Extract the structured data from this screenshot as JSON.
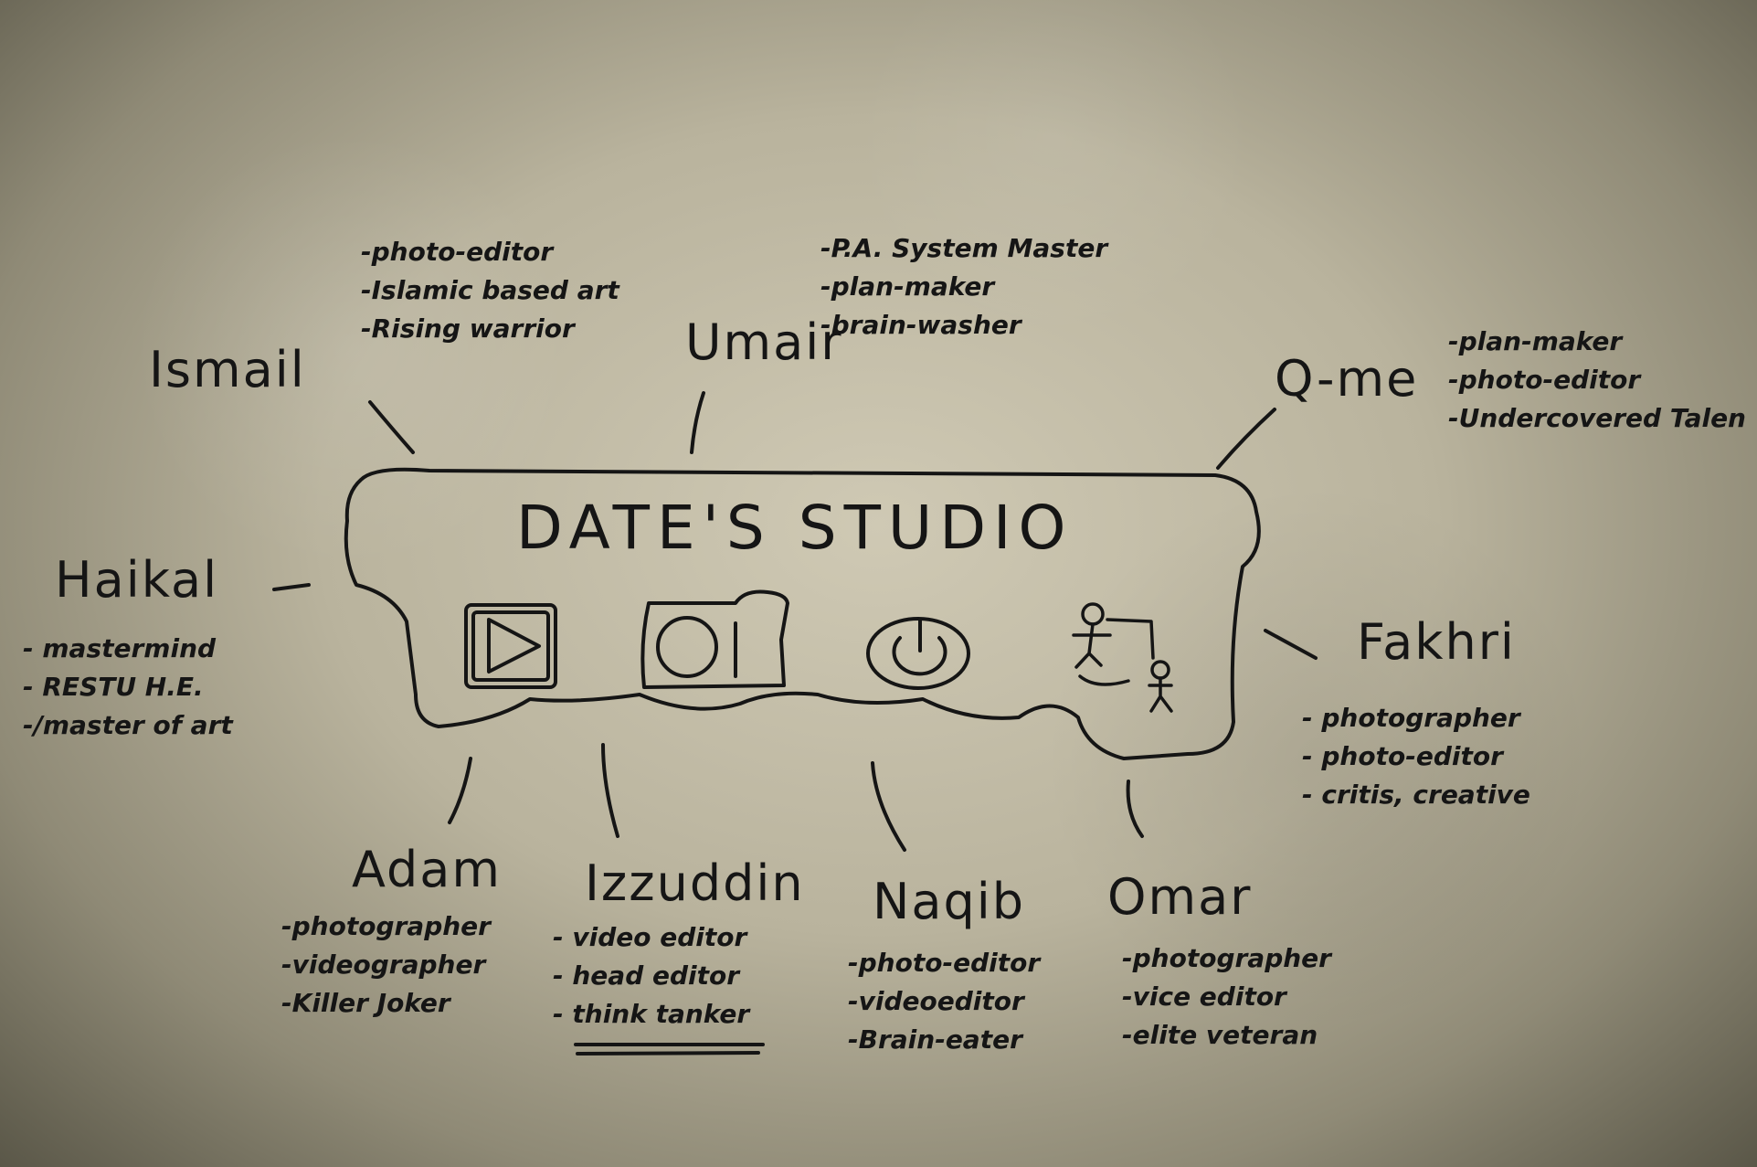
{
  "studio": {
    "title": "DATE'S STUDIO"
  },
  "icons": [
    "play-icon",
    "camera-icon",
    "power-icon",
    "figures-icon"
  ],
  "members": {
    "ismail": {
      "name": "Ismail",
      "roles": [
        "-photo-editor",
        "-Islamic based art",
        "-Rising warrior"
      ]
    },
    "umair": {
      "name": "Umair",
      "roles": [
        "-P.A. System Master",
        "-plan-maker",
        "-brain-washer"
      ]
    },
    "qme": {
      "name": "Q-me",
      "roles": [
        "-plan-maker",
        "-photo-editor",
        "-Undercovered Talen"
      ]
    },
    "haikal": {
      "name": "Haikal",
      "roles": [
        "- mastermind",
        "- RESTU H.E.",
        "-/master of art"
      ]
    },
    "fakhri": {
      "name": "Fakhri",
      "roles": [
        "- photographer",
        "- photo-editor",
        "- critis, creative"
      ]
    },
    "adam": {
      "name": "Adam",
      "roles": [
        "-photographer",
        "-videographer",
        "-Killer Joker"
      ]
    },
    "izzuddin": {
      "name": "Izzuddin",
      "roles": [
        "- video editor",
        "- head editor",
        "- think tanker"
      ]
    },
    "naqib": {
      "name": "Naqib",
      "roles": [
        "-photo-editor",
        "-videoeditor",
        "-Brain-eater"
      ]
    },
    "omar": {
      "name": "Omar",
      "roles": [
        "-photographer",
        "-vice editor",
        "-elite veteran"
      ]
    }
  }
}
